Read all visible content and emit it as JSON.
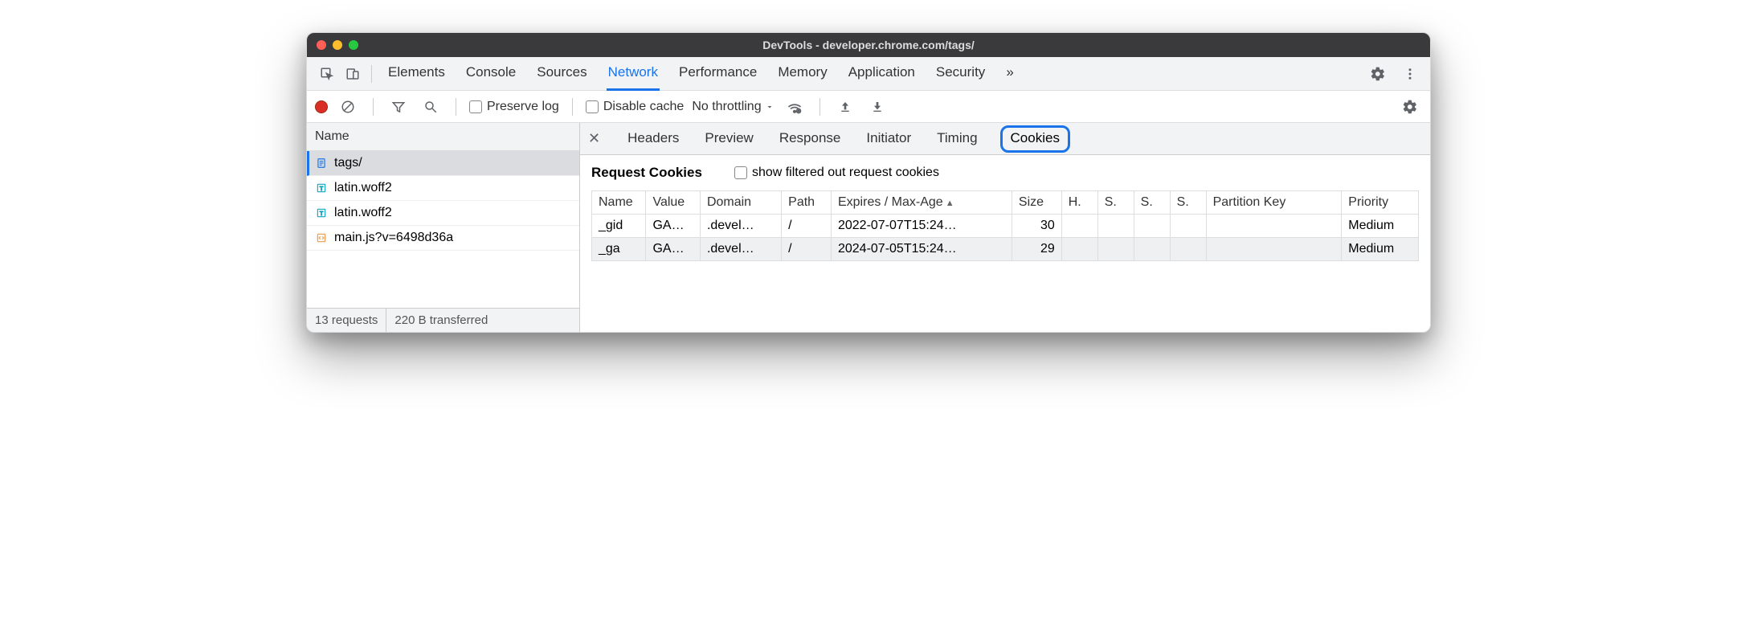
{
  "window": {
    "title": "DevTools - developer.chrome.com/tags/"
  },
  "mainTabs": {
    "items": [
      "Elements",
      "Console",
      "Sources",
      "Network",
      "Performance",
      "Memory",
      "Application",
      "Security"
    ],
    "active": "Network",
    "overflow": "»"
  },
  "subToolbar": {
    "preserveLog": "Preserve log",
    "disableCache": "Disable cache",
    "throttling": "No throttling"
  },
  "leftPane": {
    "header": "Name",
    "rows": [
      {
        "icon": "doc",
        "label": "tags/",
        "selected": true
      },
      {
        "icon": "font",
        "label": "latin.woff2",
        "selected": false
      },
      {
        "icon": "font",
        "label": "latin.woff2",
        "selected": false
      },
      {
        "icon": "script",
        "label": "main.js?v=6498d36a",
        "selected": false
      }
    ],
    "status": {
      "requests": "13 requests",
      "transferred": "220 B transferred"
    }
  },
  "detailTabs": {
    "items": [
      "Headers",
      "Preview",
      "Response",
      "Initiator",
      "Timing",
      "Cookies"
    ],
    "active": "Cookies"
  },
  "cookiesPanel": {
    "sectionTitle": "Request Cookies",
    "showFilteredLabel": "show filtered out request cookies",
    "columns": [
      "Name",
      "Value",
      "Domain",
      "Path",
      "Expires / Max-Age",
      "Size",
      "H.",
      "S.",
      "S.",
      "S.",
      "Partition Key",
      "Priority"
    ],
    "sortColumn": "Expires / Max-Age",
    "rows": [
      {
        "name": "_gid",
        "value": "GA…",
        "domain": ".devel…",
        "path": "/",
        "expires": "2022-07-07T15:24…",
        "size": "30",
        "h": "",
        "s1": "",
        "s2": "",
        "s3": "",
        "pk": "",
        "priority": "Medium"
      },
      {
        "name": "_ga",
        "value": "GA…",
        "domain": ".devel…",
        "path": "/",
        "expires": "2024-07-05T15:24…",
        "size": "29",
        "h": "",
        "s1": "",
        "s2": "",
        "s3": "",
        "pk": "",
        "priority": "Medium"
      }
    ]
  }
}
